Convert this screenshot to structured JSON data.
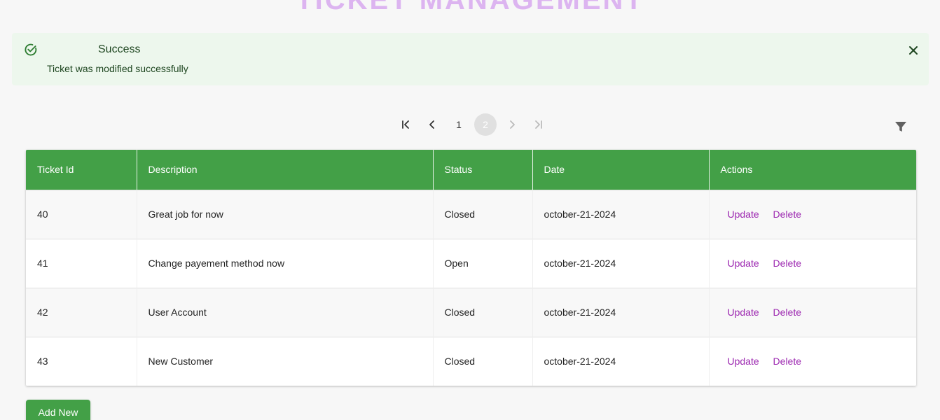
{
  "header": {
    "title": "TICKET MANAGEMENT"
  },
  "alert": {
    "title": "Success",
    "message": "Ticket was modified successfully",
    "icon": "check-circle-icon",
    "close_icon": "close-icon",
    "background": "#edf7ed",
    "color": "#1e4620"
  },
  "pagination": {
    "pages": [
      "1",
      "2"
    ],
    "current_page": "2",
    "icons": [
      "first-page-icon",
      "previous-page-icon",
      "next-page-icon",
      "last-page-icon"
    ]
  },
  "filter": {
    "icon": "filter-icon"
  },
  "table": {
    "columns": [
      "Ticket Id",
      "Description",
      "Status",
      "Date",
      "Actions"
    ],
    "header_color": "#43a047",
    "rows": [
      {
        "id": "40",
        "description": "Great job for now",
        "status": "Closed",
        "date": "october-21-2024"
      },
      {
        "id": "41",
        "description": "Change payement method now",
        "status": "Open",
        "date": "october-21-2024"
      },
      {
        "id": "42",
        "description": "User Account",
        "status": "Closed",
        "date": "october-21-2024"
      },
      {
        "id": "43",
        "description": "New Customer",
        "status": "Closed",
        "date": "october-21-2024"
      }
    ],
    "actions": {
      "update_label": "Update",
      "delete_label": "Delete",
      "color": "#9c27b0"
    }
  },
  "footer": {
    "add_label": "Add New"
  }
}
